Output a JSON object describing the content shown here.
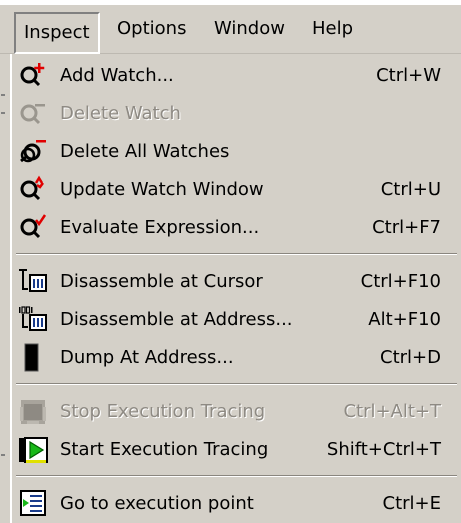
{
  "menubar": {
    "items": [
      {
        "label": "Inspect",
        "active": true
      },
      {
        "label": "Options"
      },
      {
        "label": "Window"
      },
      {
        "label": "Help"
      }
    ]
  },
  "menu": {
    "groups": [
      [
        {
          "icon": "add-watch-icon",
          "label": "Add Watch...",
          "shortcut": "Ctrl+W",
          "enabled": true
        },
        {
          "icon": "delete-watch-icon",
          "label": "Delete Watch",
          "shortcut": "",
          "enabled": false
        },
        {
          "icon": "delete-all-watches-icon",
          "label": "Delete All Watches",
          "shortcut": "",
          "enabled": true
        },
        {
          "icon": "update-watch-window-icon",
          "label": "Update Watch Window",
          "shortcut": "Ctrl+U",
          "enabled": true
        },
        {
          "icon": "evaluate-expression-icon",
          "label": "Evaluate Expression...",
          "shortcut": "Ctrl+F7",
          "enabled": true
        }
      ],
      [
        {
          "icon": "disassemble-cursor-icon",
          "label": "Disassemble at Cursor",
          "shortcut": "Ctrl+F10",
          "enabled": true
        },
        {
          "icon": "disassemble-address-icon",
          "label": "Disassemble at Address...",
          "shortcut": "Alt+F10",
          "enabled": true
        },
        {
          "icon": "dump-address-icon",
          "label": "Dump At Address...",
          "shortcut": "Ctrl+D",
          "enabled": true
        }
      ],
      [
        {
          "icon": "stop-tracing-icon",
          "label": "Stop Execution Tracing",
          "shortcut": "Ctrl+Alt+T",
          "enabled": false
        },
        {
          "icon": "start-tracing-icon",
          "label": "Start Execution Tracing",
          "shortcut": "Shift+Ctrl+T",
          "enabled": true
        }
      ],
      [
        {
          "icon": "execution-point-icon",
          "label": "Go to execution point",
          "shortcut": "Ctrl+E",
          "enabled": true
        }
      ]
    ]
  },
  "colors": {
    "menu_bg": "#d4d0c8",
    "disabled_text": "#8e8a83",
    "separator_dark": "#8a867f",
    "separator_light": "#ffffff"
  }
}
